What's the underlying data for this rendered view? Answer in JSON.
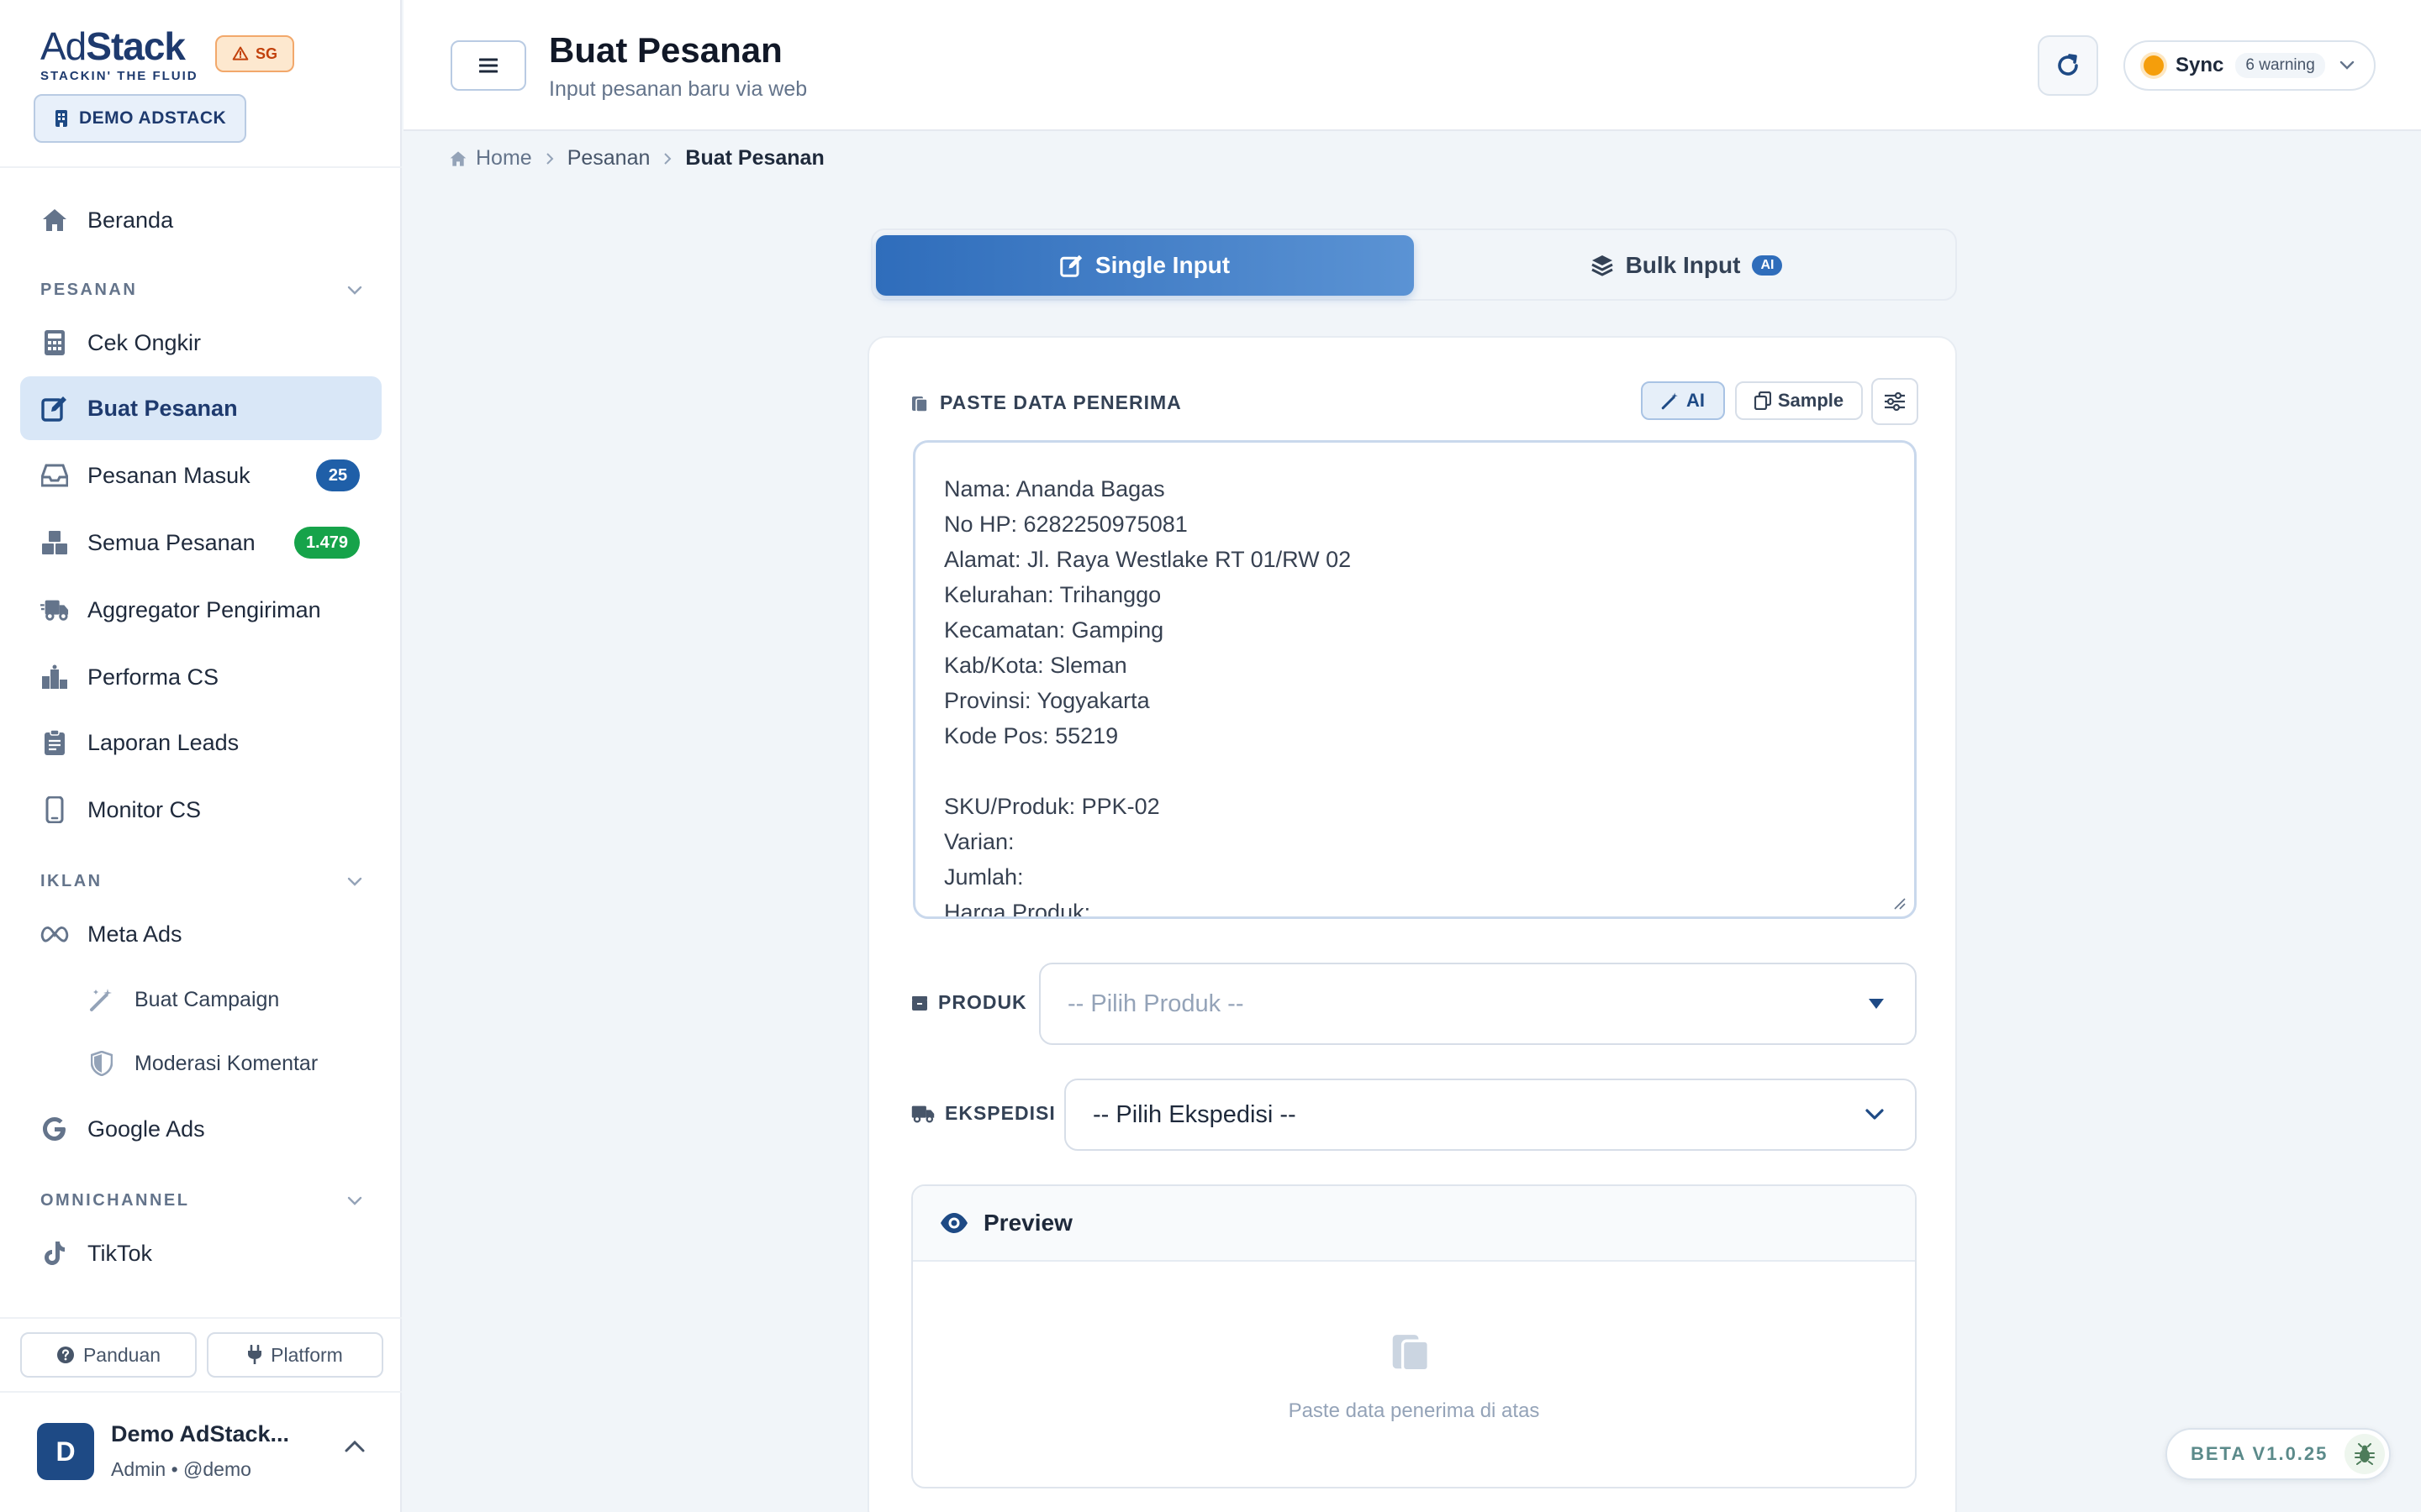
{
  "brand": {
    "logo_prefix": "Ad",
    "logo_suffix": "Stack",
    "tagline": "STACKIN' THE FLUID",
    "region_badge": "SG",
    "workspace": "DEMO ADSTACK"
  },
  "sidebar": {
    "home": "Beranda",
    "section_pesanan": "PESANAN",
    "cek_ongkir": "Cek Ongkir",
    "buat_pesanan": "Buat Pesanan",
    "pesanan_masuk": "Pesanan Masuk",
    "pesanan_masuk_count": "25",
    "semua_pesanan": "Semua Pesanan",
    "semua_pesanan_count": "1.479",
    "aggregator": "Aggregator Pengiriman",
    "performa_cs": "Performa CS",
    "laporan_leads": "Laporan Leads",
    "monitor_cs": "Monitor CS",
    "section_iklan": "IKLAN",
    "meta_ads": "Meta Ads",
    "buat_campaign": "Buat Campaign",
    "moderasi_komentar": "Moderasi Komentar",
    "google_ads": "Google Ads",
    "section_omnichannel": "OMNICHANNEL",
    "tiktok": "TikTok",
    "panduan": "Panduan",
    "platform": "Platform"
  },
  "user": {
    "initial": "D",
    "name": "Demo AdStack...",
    "role": "Admin • @demo"
  },
  "header": {
    "title": "Buat Pesanan",
    "subtitle": "Input pesanan baru via web",
    "sync_label": "Sync",
    "sync_warning": "6 warning"
  },
  "breadcrumb": {
    "home": "Home",
    "pesanan": "Pesanan",
    "current": "Buat Pesanan"
  },
  "tabs": {
    "single": "Single Input",
    "bulk": "Bulk Input",
    "bulk_badge": "AI"
  },
  "form": {
    "paste_label": "PASTE DATA PENERIMA",
    "ai_btn": "AI",
    "sample_btn": "Sample",
    "paste_lines": [
      "Nama: Ananda Bagas",
      "No HP: 6282250975081",
      "Alamat: Jl. Raya Westlake RT 01/RW 02",
      "Kelurahan: Trihanggo",
      "Kecamatan: Gamping",
      "Kab/Kota: Sleman",
      "Provinsi: Yogyakarta",
      "Kode Pos: 55219",
      "",
      "SKU/Produk: PPK-02",
      "Varian:",
      "Jumlah:",
      "Harga Produk:"
    ],
    "produk_label": "PRODUK",
    "produk_placeholder": "-- Pilih Produk --",
    "ekspedisi_label": "EKSPEDISI",
    "ekspedisi_value": "-- Pilih Ekspedisi --",
    "preview_title": "Preview",
    "preview_empty": "Paste data penerima di atas"
  },
  "footer": {
    "version": "BETA V1.0.25"
  },
  "colors": {
    "primary": "#1e4a85",
    "accent": "#2f6dbb",
    "badge_blue": "#1f5fa8",
    "badge_green": "#16a34a",
    "warning": "#f59e0b"
  }
}
